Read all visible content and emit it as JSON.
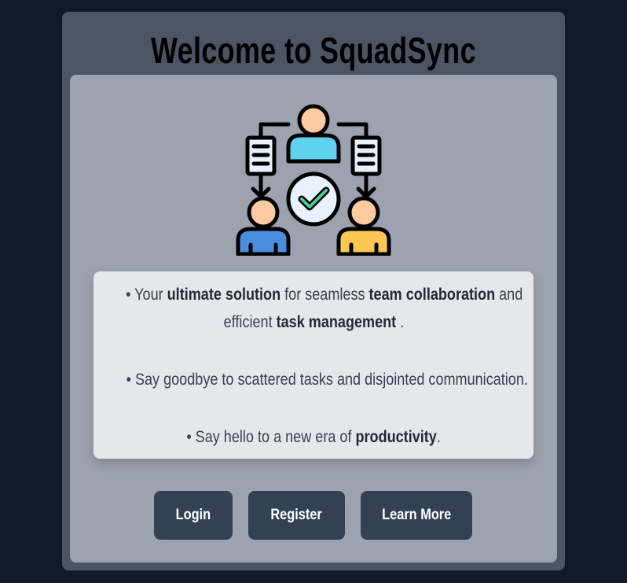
{
  "app": {
    "title": "Welcome to SquadSync"
  },
  "intro": {
    "line1_bullet": "• Your ",
    "line1_bold1": "ultimate solution",
    "line1_text2": " for seamless ",
    "line1_bold2": "team collaboration",
    "line1_text3": " and",
    "line1b_text1": "efficient ",
    "line1b_bold": "task management",
    "line1b_text2": " .",
    "line2": "• Say goodbye to scattered tasks and disjointed communication.",
    "line3_text": "• Say hello to a new era of ",
    "line3_bold": "productivity",
    "line3_end": "."
  },
  "buttons": {
    "login": "Login",
    "register": "Register",
    "learn_more": "Learn More"
  },
  "illustration": {
    "icon": "team-task-assignment-icon",
    "colors": {
      "top_person": "#5fd2ef",
      "left_person": "#4a8fdf",
      "right_person": "#fcc850",
      "skin": "#ffcaa0",
      "check": "#44d18f",
      "doc": "#e6f2ff"
    }
  }
}
